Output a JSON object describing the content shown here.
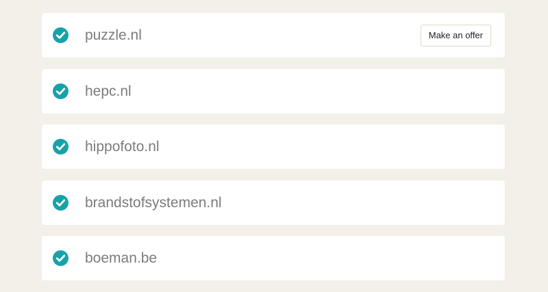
{
  "accent_color": "#17a2a8",
  "background_color": "#f3efe9",
  "offer_button_label": "Make an offer",
  "domains": [
    {
      "name": "puzzle.nl",
      "status_icon": "check-circle-icon"
    },
    {
      "name": "hepc.nl",
      "status_icon": "check-circle-icon"
    },
    {
      "name": "hippofoto.nl",
      "status_icon": "check-circle-icon"
    },
    {
      "name": "brandstofsystemen.nl",
      "status_icon": "check-circle-icon"
    },
    {
      "name": "boeman.be",
      "status_icon": "check-circle-icon"
    }
  ]
}
